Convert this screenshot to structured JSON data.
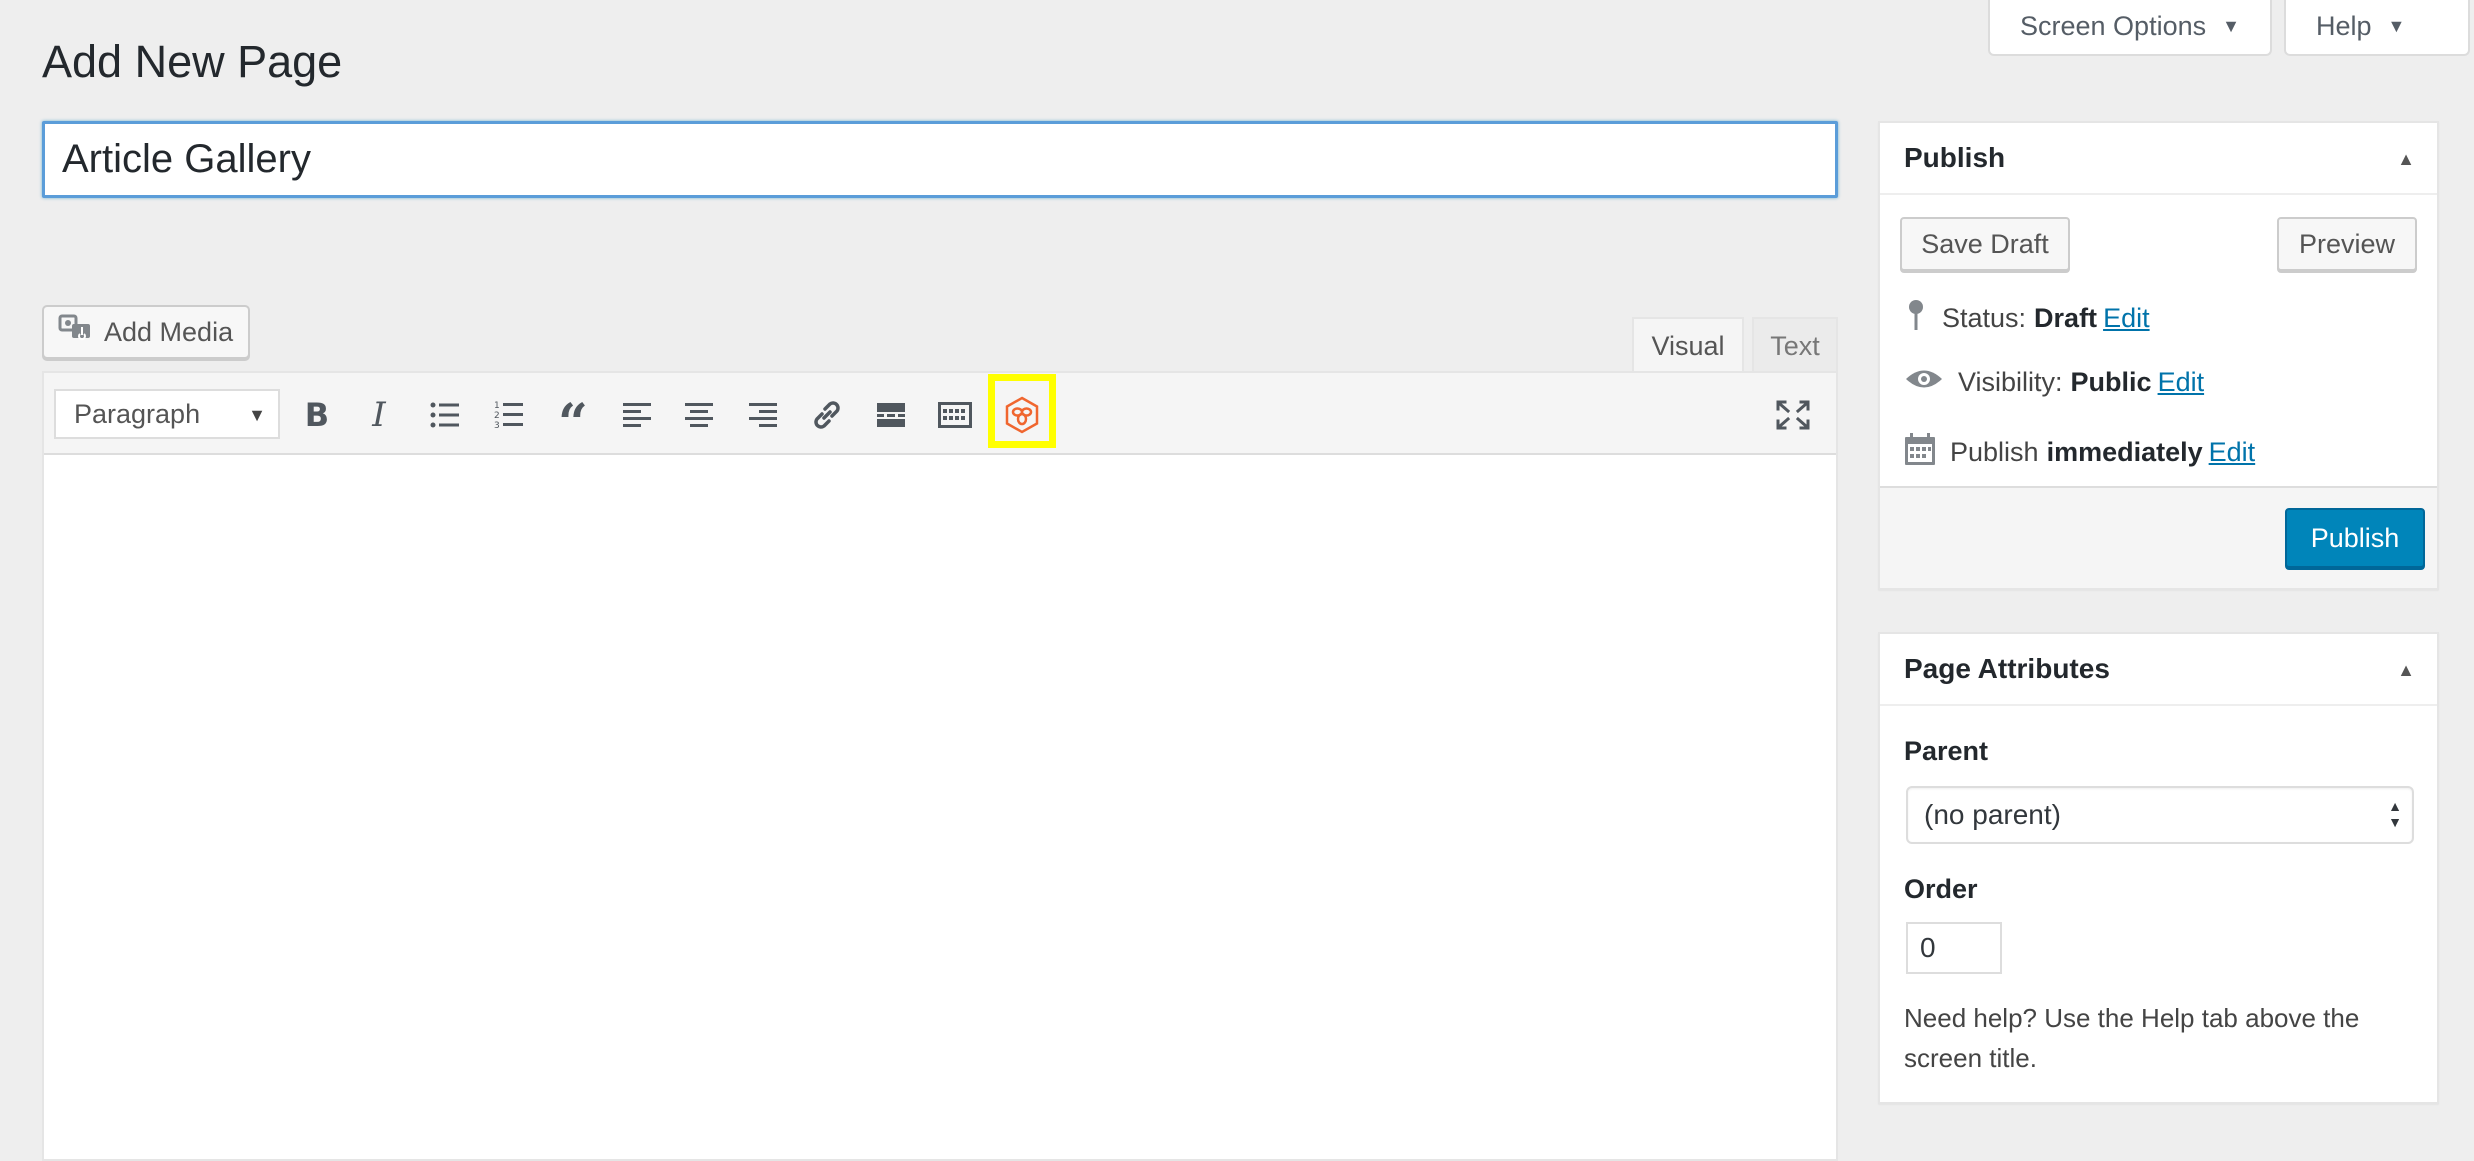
{
  "screen_meta": {
    "screen_options_label": "Screen Options",
    "help_label": "Help"
  },
  "page_title": "Add New Page",
  "title_field": {
    "value": "Article Gallery"
  },
  "add_media_label": "Add Media",
  "editor_tabs": {
    "visual": "Visual",
    "text": "Text"
  },
  "toolbar": {
    "format_select_value": "Paragraph",
    "buttons": [
      "bold-icon",
      "italic-icon",
      "bulleted-list-icon",
      "numbered-list-icon",
      "blockquote-icon",
      "align-left-icon",
      "align-center-icon",
      "align-right-icon",
      "link-icon",
      "read-more-icon",
      "toolbar-toggle-icon",
      "gallery-plugin-icon",
      "fullscreen-icon"
    ],
    "highlight_color": "#ffff00",
    "plugin_icon_color": "#f0662f"
  },
  "publish_box": {
    "title": "Publish",
    "save_draft_label": "Save Draft",
    "preview_label": "Preview",
    "status_label": "Status:",
    "status_value": "Draft",
    "visibility_label": "Visibility:",
    "visibility_value": "Public",
    "publish_label": "Publish",
    "publish_when": "immediately",
    "edit_link": "Edit",
    "publish_button_label": "Publish",
    "publish_button_color": "#0085ba"
  },
  "page_attributes": {
    "title": "Page Attributes",
    "parent_label": "Parent",
    "parent_value": "(no parent)",
    "order_label": "Order",
    "order_value": "0",
    "help_text": "Need help? Use the Help tab above the screen title."
  }
}
